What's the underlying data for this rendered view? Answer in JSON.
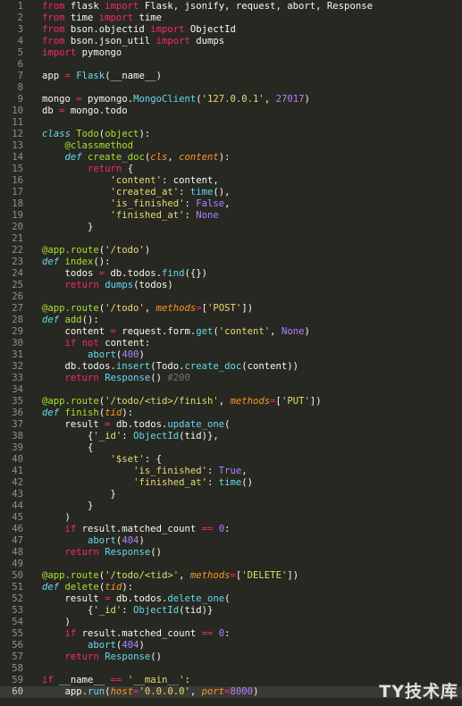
{
  "colors": {
    "background": "#272822",
    "current_line": "#3a3a34",
    "line_number": "#8f908a",
    "text": "#f8f8f2",
    "keyword": "#f92672",
    "string": "#e6db74",
    "number": "#ae81ff",
    "function": "#a6e22e",
    "builtin": "#66d9ef",
    "parameter": "#fd971f",
    "comment": "#75715e"
  },
  "editor": {
    "current_line": 60,
    "lines": [
      {
        "n": "1",
        "t": [
          [
            "kw",
            "from"
          ],
          [
            "tx",
            " flask "
          ],
          [
            "kw",
            "import"
          ],
          [
            "tx",
            " Flask, jsonify, request, abort, Response"
          ]
        ]
      },
      {
        "n": "2",
        "t": [
          [
            "kw",
            "from"
          ],
          [
            "tx",
            " time "
          ],
          [
            "kw",
            "import"
          ],
          [
            "tx",
            " time"
          ]
        ]
      },
      {
        "n": "3",
        "t": [
          [
            "kw",
            "from"
          ],
          [
            "tx",
            " bson.objectid "
          ],
          [
            "kw",
            "import"
          ],
          [
            "tx",
            " ObjectId"
          ]
        ]
      },
      {
        "n": "4",
        "t": [
          [
            "kw",
            "from"
          ],
          [
            "tx",
            " bson.json_util "
          ],
          [
            "kw",
            "import"
          ],
          [
            "tx",
            " dumps"
          ]
        ]
      },
      {
        "n": "5",
        "t": [
          [
            "kw",
            "import"
          ],
          [
            "tx",
            " pymongo"
          ]
        ]
      },
      {
        "n": "6",
        "t": []
      },
      {
        "n": "7",
        "t": [
          [
            "tx",
            "app "
          ],
          [
            "kw",
            "="
          ],
          [
            "tx",
            " "
          ],
          [
            "bi",
            "Flask"
          ],
          [
            "tx",
            "(__name__)"
          ]
        ]
      },
      {
        "n": "8",
        "t": []
      },
      {
        "n": "9",
        "t": [
          [
            "tx",
            "mongo "
          ],
          [
            "kw",
            "="
          ],
          [
            "tx",
            " pymongo."
          ],
          [
            "bi",
            "MongoClient"
          ],
          [
            "tx",
            "("
          ],
          [
            "st",
            "'127.0.0.1'"
          ],
          [
            "tx",
            ", "
          ],
          [
            "nm",
            "27017"
          ],
          [
            "tx",
            ")"
          ]
        ]
      },
      {
        "n": "10",
        "t": [
          [
            "tx",
            "db "
          ],
          [
            "kw",
            "="
          ],
          [
            "tx",
            " mongo.todo"
          ]
        ]
      },
      {
        "n": "11",
        "t": []
      },
      {
        "n": "12",
        "t": [
          [
            "ca",
            "class"
          ],
          [
            "tx",
            " "
          ],
          [
            "fn",
            "Todo"
          ],
          [
            "tx",
            "("
          ],
          [
            "fn",
            "object"
          ],
          [
            "tx",
            "):"
          ]
        ]
      },
      {
        "n": "13",
        "t": [
          [
            "tx",
            "    "
          ],
          [
            "fn",
            "@classmethod"
          ]
        ]
      },
      {
        "n": "14",
        "t": [
          [
            "tx",
            "    "
          ],
          [
            "ca",
            "def"
          ],
          [
            "tx",
            " "
          ],
          [
            "fn",
            "create_doc"
          ],
          [
            "tx",
            "("
          ],
          [
            "pa",
            "cls"
          ],
          [
            "tx",
            ", "
          ],
          [
            "pa",
            "content"
          ],
          [
            "tx",
            "):"
          ]
        ]
      },
      {
        "n": "15",
        "t": [
          [
            "tx",
            "        "
          ],
          [
            "kw",
            "return"
          ],
          [
            "tx",
            " {"
          ]
        ]
      },
      {
        "n": "16",
        "t": [
          [
            "tx",
            "            "
          ],
          [
            "st",
            "'content'"
          ],
          [
            "tx",
            ": content,"
          ]
        ]
      },
      {
        "n": "17",
        "t": [
          [
            "tx",
            "            "
          ],
          [
            "st",
            "'created_at'"
          ],
          [
            "tx",
            ": "
          ],
          [
            "bi",
            "time"
          ],
          [
            "tx",
            "(),"
          ]
        ]
      },
      {
        "n": "18",
        "t": [
          [
            "tx",
            "            "
          ],
          [
            "st",
            "'is_finished'"
          ],
          [
            "tx",
            ": "
          ],
          [
            "nm",
            "False"
          ],
          [
            "tx",
            ","
          ]
        ]
      },
      {
        "n": "19",
        "t": [
          [
            "tx",
            "            "
          ],
          [
            "st",
            "'finished_at'"
          ],
          [
            "tx",
            ": "
          ],
          [
            "nm",
            "None"
          ]
        ]
      },
      {
        "n": "20",
        "t": [
          [
            "tx",
            "        }"
          ]
        ]
      },
      {
        "n": "21",
        "t": []
      },
      {
        "n": "22",
        "t": [
          [
            "fn",
            "@app.route"
          ],
          [
            "tx",
            "("
          ],
          [
            "st",
            "'/todo'"
          ],
          [
            "tx",
            ")"
          ]
        ]
      },
      {
        "n": "23",
        "t": [
          [
            "ca",
            "def"
          ],
          [
            "tx",
            " "
          ],
          [
            "fn",
            "index"
          ],
          [
            "tx",
            "():"
          ]
        ]
      },
      {
        "n": "24",
        "t": [
          [
            "tx",
            "    todos "
          ],
          [
            "kw",
            "="
          ],
          [
            "tx",
            " db.todos."
          ],
          [
            "bi",
            "find"
          ],
          [
            "tx",
            "({})"
          ]
        ]
      },
      {
        "n": "25",
        "t": [
          [
            "tx",
            "    "
          ],
          [
            "kw",
            "return"
          ],
          [
            "tx",
            " "
          ],
          [
            "bi",
            "dumps"
          ],
          [
            "tx",
            "(todos)"
          ]
        ]
      },
      {
        "n": "26",
        "t": []
      },
      {
        "n": "27",
        "t": [
          [
            "fn",
            "@app.route"
          ],
          [
            "tx",
            "("
          ],
          [
            "st",
            "'/todo'"
          ],
          [
            "tx",
            ", "
          ],
          [
            "pa",
            "methods"
          ],
          [
            "kw",
            "="
          ],
          [
            "tx",
            "["
          ],
          [
            "st",
            "'POST'"
          ],
          [
            "tx",
            "])"
          ]
        ]
      },
      {
        "n": "28",
        "t": [
          [
            "ca",
            "def"
          ],
          [
            "tx",
            " "
          ],
          [
            "fn",
            "add"
          ],
          [
            "tx",
            "():"
          ]
        ]
      },
      {
        "n": "29",
        "t": [
          [
            "tx",
            "    content "
          ],
          [
            "kw",
            "="
          ],
          [
            "tx",
            " request.form."
          ],
          [
            "bi",
            "get"
          ],
          [
            "tx",
            "("
          ],
          [
            "st",
            "'content'"
          ],
          [
            "tx",
            ", "
          ],
          [
            "nm",
            "None"
          ],
          [
            "tx",
            ")"
          ]
        ]
      },
      {
        "n": "30",
        "t": [
          [
            "tx",
            "    "
          ],
          [
            "kw",
            "if"
          ],
          [
            "tx",
            " "
          ],
          [
            "kw",
            "not"
          ],
          [
            "tx",
            " content:"
          ]
        ]
      },
      {
        "n": "31",
        "t": [
          [
            "tx",
            "        "
          ],
          [
            "bi",
            "abort"
          ],
          [
            "tx",
            "("
          ],
          [
            "nm",
            "400"
          ],
          [
            "tx",
            ")"
          ]
        ]
      },
      {
        "n": "32",
        "t": [
          [
            "tx",
            "    db.todos."
          ],
          [
            "bi",
            "insert"
          ],
          [
            "tx",
            "(Todo."
          ],
          [
            "bi",
            "create_doc"
          ],
          [
            "tx",
            "(content))"
          ]
        ]
      },
      {
        "n": "33",
        "t": [
          [
            "tx",
            "    "
          ],
          [
            "kw",
            "return"
          ],
          [
            "tx",
            " "
          ],
          [
            "bi",
            "Response"
          ],
          [
            "tx",
            "() "
          ],
          [
            "cm",
            "#200"
          ]
        ]
      },
      {
        "n": "34",
        "t": []
      },
      {
        "n": "35",
        "t": [
          [
            "fn",
            "@app.route"
          ],
          [
            "tx",
            "("
          ],
          [
            "st",
            "'/todo/<tid>/finish'"
          ],
          [
            "tx",
            ", "
          ],
          [
            "pa",
            "methods"
          ],
          [
            "kw",
            "="
          ],
          [
            "tx",
            "["
          ],
          [
            "st",
            "'PUT'"
          ],
          [
            "tx",
            "])"
          ]
        ]
      },
      {
        "n": "36",
        "t": [
          [
            "ca",
            "def"
          ],
          [
            "tx",
            " "
          ],
          [
            "fn",
            "finish"
          ],
          [
            "tx",
            "("
          ],
          [
            "pa",
            "tid"
          ],
          [
            "tx",
            "):"
          ]
        ]
      },
      {
        "n": "37",
        "t": [
          [
            "tx",
            "    result "
          ],
          [
            "kw",
            "="
          ],
          [
            "tx",
            " db.todos."
          ],
          [
            "bi",
            "update_one"
          ],
          [
            "tx",
            "("
          ]
        ]
      },
      {
        "n": "38",
        "t": [
          [
            "tx",
            "        {"
          ],
          [
            "st",
            "'_id'"
          ],
          [
            "tx",
            ": "
          ],
          [
            "bi",
            "ObjectId"
          ],
          [
            "tx",
            "(tid)},"
          ]
        ]
      },
      {
        "n": "39",
        "t": [
          [
            "tx",
            "        {"
          ]
        ]
      },
      {
        "n": "40",
        "t": [
          [
            "tx",
            "            "
          ],
          [
            "st",
            "'$set'"
          ],
          [
            "tx",
            ": {"
          ]
        ]
      },
      {
        "n": "41",
        "t": [
          [
            "tx",
            "                "
          ],
          [
            "st",
            "'is_finished'"
          ],
          [
            "tx",
            ": "
          ],
          [
            "nm",
            "True"
          ],
          [
            "tx",
            ","
          ]
        ]
      },
      {
        "n": "42",
        "t": [
          [
            "tx",
            "                "
          ],
          [
            "st",
            "'finished_at'"
          ],
          [
            "tx",
            ": "
          ],
          [
            "bi",
            "time"
          ],
          [
            "tx",
            "()"
          ]
        ]
      },
      {
        "n": "43",
        "t": [
          [
            "tx",
            "            }"
          ]
        ]
      },
      {
        "n": "44",
        "t": [
          [
            "tx",
            "        }"
          ]
        ]
      },
      {
        "n": "45",
        "t": [
          [
            "tx",
            "    )"
          ]
        ]
      },
      {
        "n": "46",
        "t": [
          [
            "tx",
            "    "
          ],
          [
            "kw",
            "if"
          ],
          [
            "tx",
            " result.matched_count "
          ],
          [
            "kw",
            "=="
          ],
          [
            "tx",
            " "
          ],
          [
            "nm",
            "0"
          ],
          [
            "tx",
            ":"
          ]
        ]
      },
      {
        "n": "47",
        "t": [
          [
            "tx",
            "        "
          ],
          [
            "bi",
            "abort"
          ],
          [
            "tx",
            "("
          ],
          [
            "nm",
            "404"
          ],
          [
            "tx",
            ")"
          ]
        ]
      },
      {
        "n": "48",
        "t": [
          [
            "tx",
            "    "
          ],
          [
            "kw",
            "return"
          ],
          [
            "tx",
            " "
          ],
          [
            "bi",
            "Response"
          ],
          [
            "tx",
            "()"
          ]
        ]
      },
      {
        "n": "49",
        "t": []
      },
      {
        "n": "50",
        "t": [
          [
            "fn",
            "@app.route"
          ],
          [
            "tx",
            "("
          ],
          [
            "st",
            "'/todo/<tid>'"
          ],
          [
            "tx",
            ", "
          ],
          [
            "pa",
            "methods"
          ],
          [
            "kw",
            "="
          ],
          [
            "tx",
            "["
          ],
          [
            "st",
            "'DELETE'"
          ],
          [
            "tx",
            "])"
          ]
        ]
      },
      {
        "n": "51",
        "t": [
          [
            "ca",
            "def"
          ],
          [
            "tx",
            " "
          ],
          [
            "fn",
            "delete"
          ],
          [
            "tx",
            "("
          ],
          [
            "pa",
            "tid"
          ],
          [
            "tx",
            "):"
          ]
        ]
      },
      {
        "n": "52",
        "t": [
          [
            "tx",
            "    result "
          ],
          [
            "kw",
            "="
          ],
          [
            "tx",
            " db.todos."
          ],
          [
            "bi",
            "delete_one"
          ],
          [
            "tx",
            "("
          ]
        ]
      },
      {
        "n": "53",
        "t": [
          [
            "tx",
            "        {"
          ],
          [
            "st",
            "'_id'"
          ],
          [
            "tx",
            ": "
          ],
          [
            "bi",
            "ObjectId"
          ],
          [
            "tx",
            "(tid)}"
          ]
        ]
      },
      {
        "n": "54",
        "t": [
          [
            "tx",
            "    )"
          ]
        ]
      },
      {
        "n": "55",
        "t": [
          [
            "tx",
            "    "
          ],
          [
            "kw",
            "if"
          ],
          [
            "tx",
            " result.matched_count "
          ],
          [
            "kw",
            "=="
          ],
          [
            "tx",
            " "
          ],
          [
            "nm",
            "0"
          ],
          [
            "tx",
            ":"
          ]
        ]
      },
      {
        "n": "56",
        "t": [
          [
            "tx",
            "        "
          ],
          [
            "bi",
            "abort"
          ],
          [
            "tx",
            "("
          ],
          [
            "nm",
            "404"
          ],
          [
            "tx",
            ")"
          ]
        ]
      },
      {
        "n": "57",
        "t": [
          [
            "tx",
            "    "
          ],
          [
            "kw",
            "return"
          ],
          [
            "tx",
            " "
          ],
          [
            "bi",
            "Response"
          ],
          [
            "tx",
            "()"
          ]
        ]
      },
      {
        "n": "58",
        "t": []
      },
      {
        "n": "59",
        "t": [
          [
            "kw",
            "if"
          ],
          [
            "tx",
            " __name__ "
          ],
          [
            "kw",
            "=="
          ],
          [
            "tx",
            " "
          ],
          [
            "st",
            "'__main__'"
          ],
          [
            "tx",
            ":"
          ]
        ]
      },
      {
        "n": "60",
        "t": [
          [
            "tx",
            "    app."
          ],
          [
            "bi",
            "run"
          ],
          [
            "tx",
            "("
          ],
          [
            "pa",
            "host"
          ],
          [
            "kw",
            "="
          ],
          [
            "st",
            "'0.0.0.0'"
          ],
          [
            "tx",
            ", "
          ],
          [
            "pa",
            "port"
          ],
          [
            "kw",
            "="
          ],
          [
            "nm",
            "8000"
          ],
          [
            "tx",
            ")"
          ]
        ]
      }
    ]
  },
  "watermark": {
    "text": "TY技术库"
  }
}
